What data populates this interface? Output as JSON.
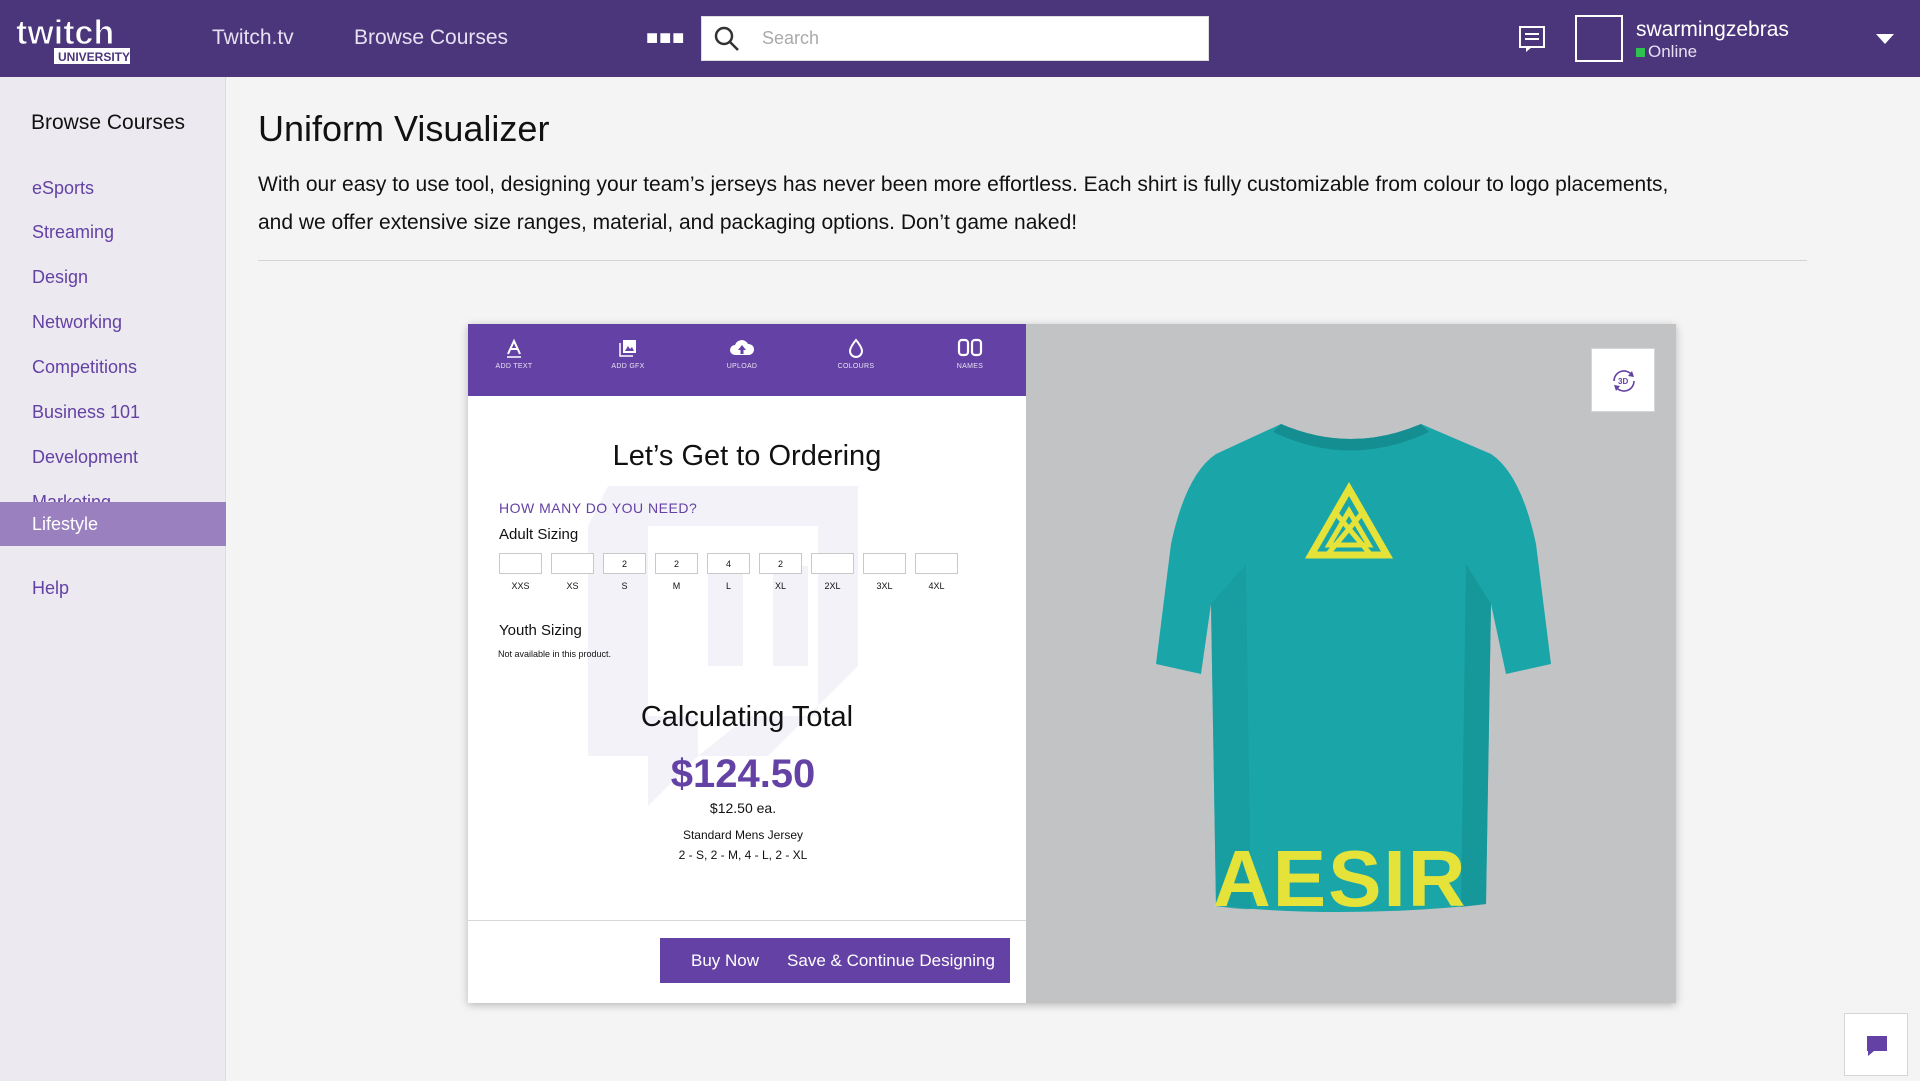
{
  "header": {
    "logo_text": "twitch",
    "logo_sub": "UNIVERSITY",
    "nav": [
      "Twitch.tv",
      "Browse Courses"
    ],
    "search_placeholder": "Search",
    "username": "swarmingzebras",
    "status": "Online"
  },
  "sidebar": {
    "heading": "Browse Courses",
    "items": [
      {
        "label": "eSports"
      },
      {
        "label": "Streaming"
      },
      {
        "label": "Design"
      },
      {
        "label": "Networking"
      },
      {
        "label": "Competitions"
      },
      {
        "label": "Business 101"
      },
      {
        "label": "Development"
      },
      {
        "label": "Marketing"
      },
      {
        "label": "Lifestyle",
        "active": true
      },
      {
        "label": "Help"
      }
    ]
  },
  "main": {
    "title": "Uniform Visualizer",
    "intro": "With our easy to use tool, designing your team’s jerseys has never been more effortless. Each shirt is fully customizable from colour to logo placements, and we offer extensive size ranges, material, and packaging options. Don’t game naked!"
  },
  "visualizer": {
    "tools": [
      {
        "label": "ADD TEXT",
        "icon": "text-icon"
      },
      {
        "label": "ADD GFX",
        "icon": "image-icon"
      },
      {
        "label": "UPLOAD",
        "icon": "cloud-upload-icon"
      },
      {
        "label": "COLOURS",
        "icon": "droplet-icon"
      },
      {
        "label": "NAMES",
        "icon": "numbers-icon"
      }
    ],
    "order_title": "Let’s Get to Ordering",
    "how_many": "HOW MANY DO YOU NEED?",
    "adult_label": "Adult Sizing",
    "sizes": [
      {
        "label": "XXS",
        "qty": ""
      },
      {
        "label": "XS",
        "qty": ""
      },
      {
        "label": "S",
        "qty": "2"
      },
      {
        "label": "M",
        "qty": "2"
      },
      {
        "label": "L",
        "qty": "4"
      },
      {
        "label": "XL",
        "qty": "2"
      },
      {
        "label": "2XL",
        "qty": ""
      },
      {
        "label": "3XL",
        "qty": ""
      },
      {
        "label": "4XL",
        "qty": ""
      }
    ],
    "youth_label": "Youth Sizing",
    "youth_note": "Not available in this product.",
    "calc_title": "Calculating Total",
    "total": "$124.50",
    "each": "$12.50 ea.",
    "product": "Standard Mens Jersey",
    "breakdown": "2 - S, 2 - M, 4 - L, 2 - XL",
    "buy_label": "Buy Now",
    "save_label": "Save & Continue Designing",
    "view_3d_label": "3D",
    "shirt_text": "AESIR",
    "shirt_color": "#1aa6a8",
    "print_color": "#e5e23a"
  },
  "colors": {
    "brand": "#6441a4",
    "topbar": "#4b367c",
    "active_nav": "#9b80bf"
  }
}
